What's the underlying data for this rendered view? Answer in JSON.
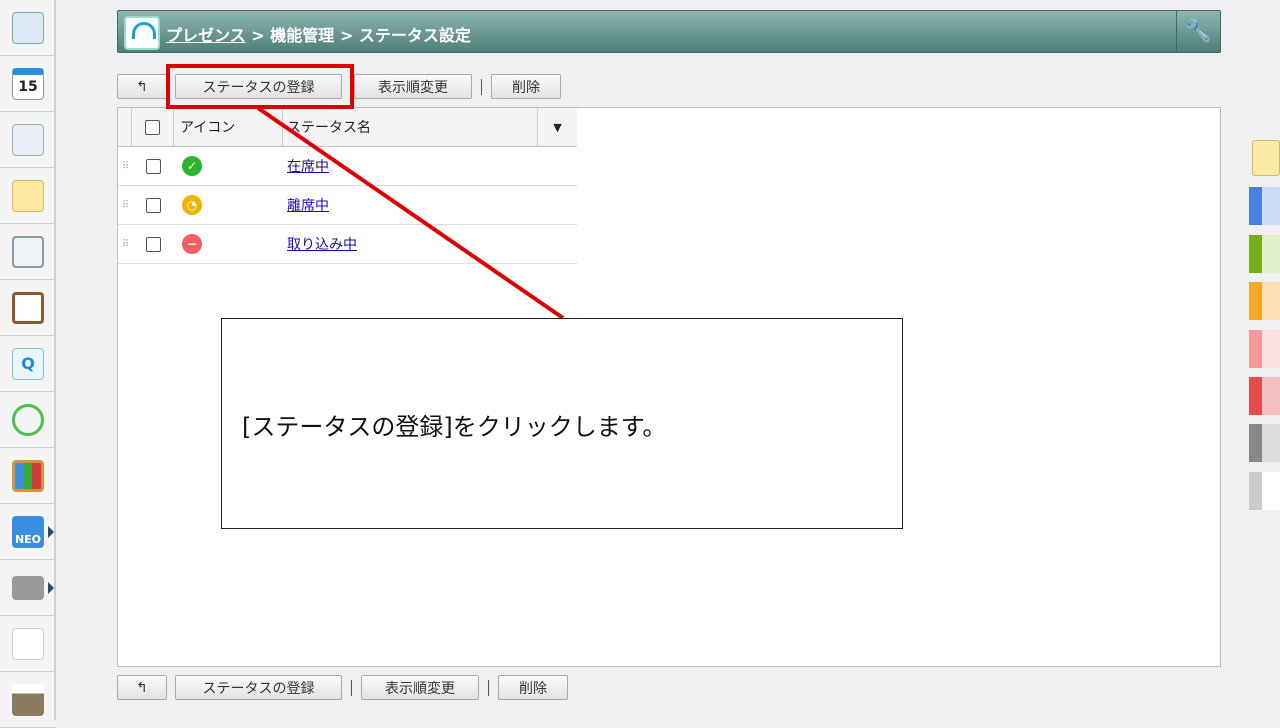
{
  "sidebar": {
    "items": [
      {
        "icon": "portal-icon"
      },
      {
        "icon": "calendar-icon",
        "label": "15"
      },
      {
        "icon": "presentation-icon"
      },
      {
        "icon": "memo-icon"
      },
      {
        "icon": "bulletin-icon"
      },
      {
        "icon": "clipboard-icon"
      },
      {
        "icon": "survey-icon"
      },
      {
        "icon": "workflow-icon"
      },
      {
        "icon": "cabinet-icon"
      },
      {
        "icon": "neo-icon",
        "label": "NEO"
      },
      {
        "icon": "folder-icon"
      },
      {
        "icon": "tanomail-icon"
      },
      {
        "icon": "banner-icon"
      }
    ]
  },
  "header": {
    "crumb_root": "プレゼンス",
    "sep": ">",
    "crumb_mid": "機能管理",
    "crumb_current": "ステータス設定"
  },
  "toolbar": {
    "back": "↰",
    "register": "ステータスの登録",
    "reorder": "表示順変更",
    "delete": "削除"
  },
  "table": {
    "columns": {
      "icon": "アイコン",
      "name": "ステータス名"
    },
    "rows": [
      {
        "name": "在席中",
        "status": "present",
        "color": "#2db52d",
        "glyph": "✓"
      },
      {
        "name": "離席中",
        "status": "away",
        "color": "#f0b400",
        "glyph": "◔"
      },
      {
        "name": "取り込み中",
        "status": "busy",
        "color": "#f06060",
        "glyph": "−"
      }
    ]
  },
  "callout": {
    "text": "[ステータスの登録]をクリックします。"
  },
  "highlight_color": "#e00000",
  "right_tabs": [
    {
      "a": "#4a7fe0",
      "b": "#cddcf6"
    },
    {
      "a": "#78ad1e",
      "b": "#dff0c8"
    },
    {
      "a": "#f7a829",
      "b": "#fde0b4"
    },
    {
      "a": "#f59a9a",
      "b": "#fde0e0"
    },
    {
      "a": "#e84b4b",
      "b": "#f7c0c0"
    },
    {
      "a": "#888888",
      "b": "#dddddd"
    },
    {
      "a": "#cccccc",
      "b": "#ffffff"
    }
  ]
}
